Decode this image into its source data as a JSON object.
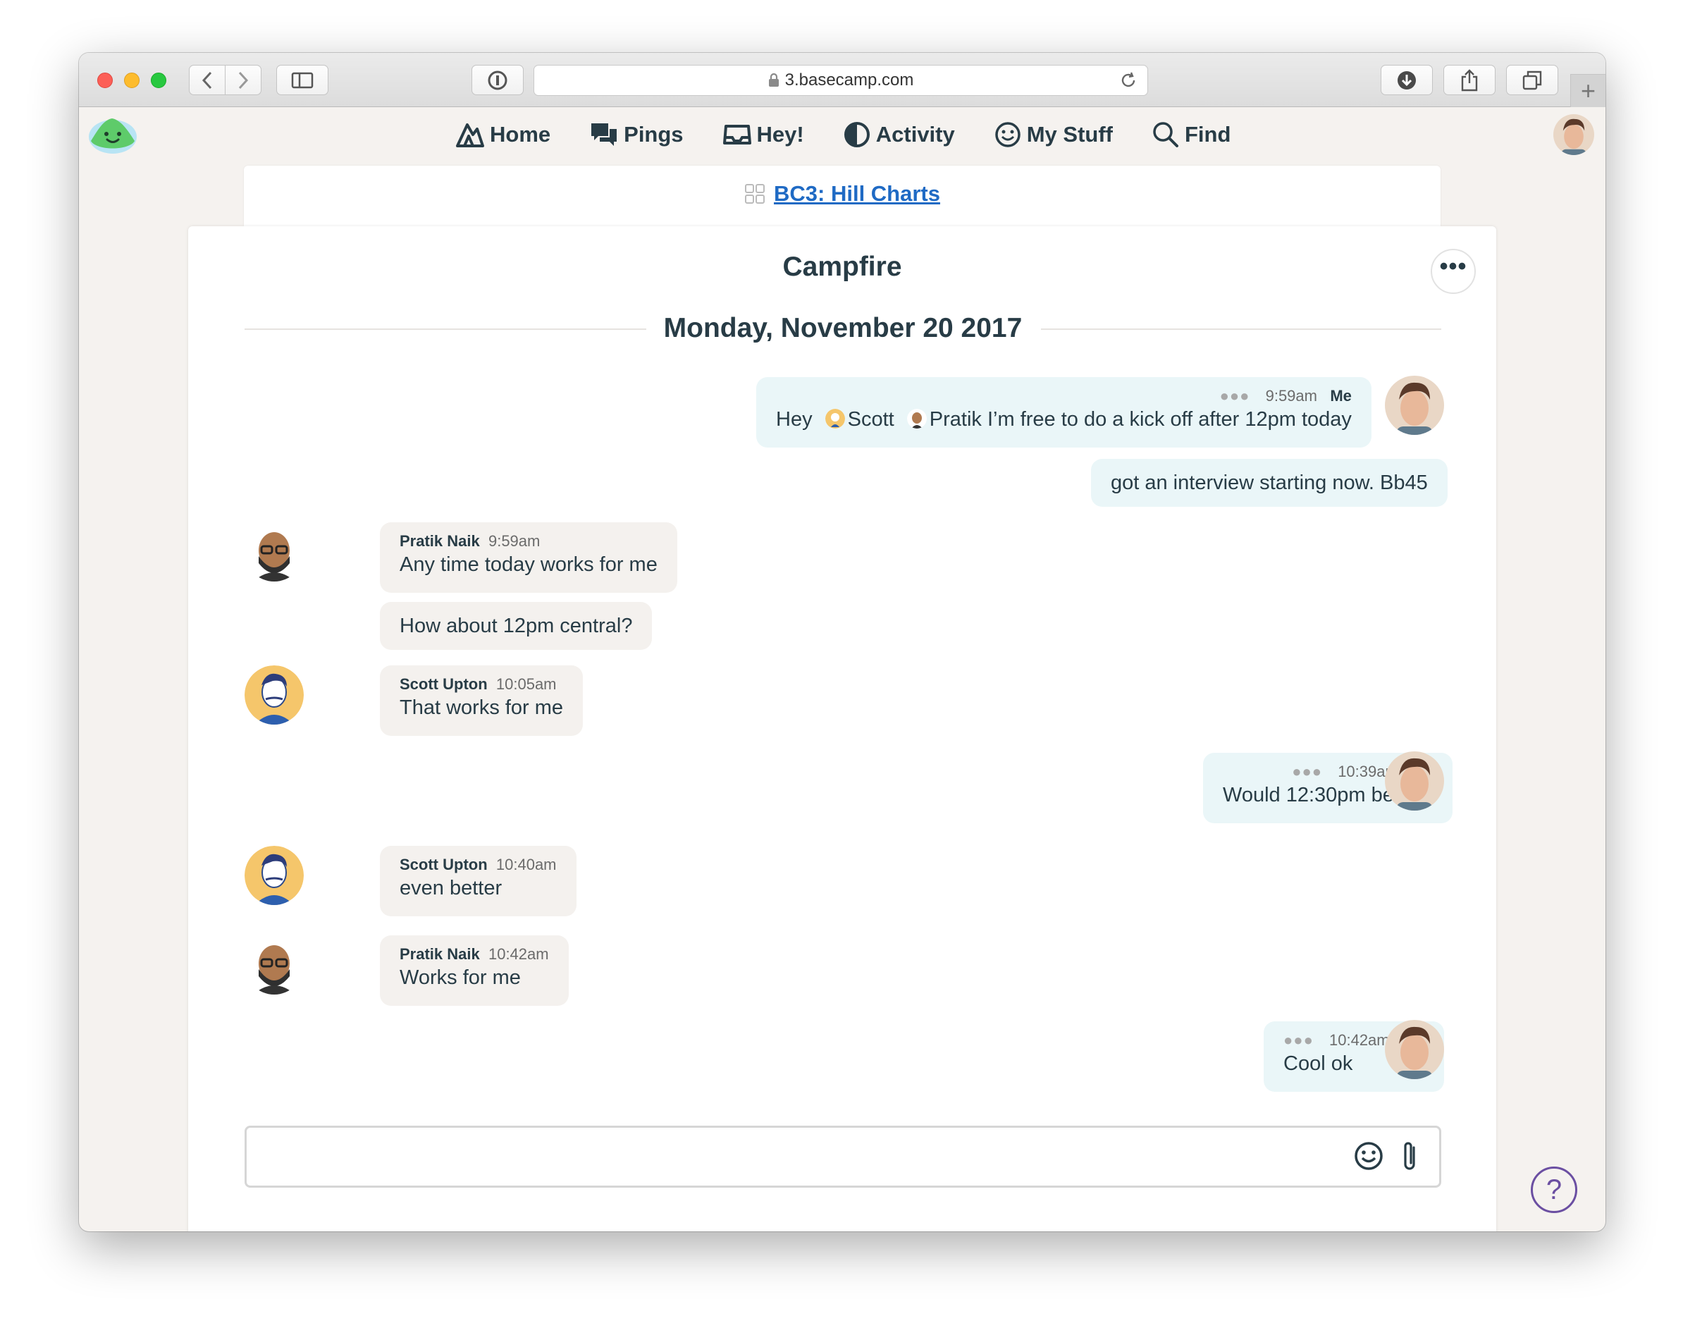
{
  "browser": {
    "url": "3.basecamp.com",
    "buttons": [
      "back",
      "forward",
      "sidebar",
      "password",
      "download",
      "share",
      "tabs",
      "new-tab"
    ]
  },
  "nav": {
    "items": [
      {
        "label": "Home",
        "icon": "mountain-icon"
      },
      {
        "label": "Pings",
        "icon": "chat-bubbles-icon"
      },
      {
        "label": "Hey!",
        "icon": "inbox-icon"
      },
      {
        "label": "Activity",
        "icon": "activity-icon"
      },
      {
        "label": "My Stuff",
        "icon": "smiley-icon"
      },
      {
        "label": "Find",
        "icon": "search-icon"
      }
    ]
  },
  "project": {
    "name": "BC3: Hill Charts"
  },
  "page": {
    "title": "Campfire",
    "more_label": "•••"
  },
  "day": {
    "date": "Monday, November 20 2017"
  },
  "messages": {
    "m1": {
      "time": "9:59am",
      "author": "Me",
      "text_a": "Hey",
      "mention_1": "Scott",
      "mention_2": "Pratik",
      "text_b": "I’m free to do a kick off after 12pm today",
      "text2": "got an interview starting now. Bb45"
    },
    "m2": {
      "author": "Pratik Naik",
      "time": "9:59am",
      "text": "Any time today works for me",
      "text2": "How about 12pm central?"
    },
    "m3": {
      "author": "Scott Upton",
      "time": "10:05am",
      "text": "That works for me"
    },
    "m4": {
      "time": "10:39am",
      "author": "Me",
      "text": "Would 12:30pm be ok?"
    },
    "m5": {
      "author": "Scott Upton",
      "time": "10:40am",
      "text": "even better"
    },
    "m6": {
      "author": "Pratik Naik",
      "time": "10:42am",
      "text": "Works for me"
    },
    "m7": {
      "time": "10:42am",
      "author": "Me",
      "text": "Cool ok"
    }
  },
  "composer": {
    "value": "",
    "emoji_icon": "smiley-icon",
    "attach_icon": "paperclip-icon"
  },
  "help": {
    "label": "?"
  },
  "colors": {
    "link": "#1f6ac4",
    "mine_bubble": "#eaf6f8",
    "theirs_bubble": "#f4f1ee",
    "help": "#6b4fa2"
  }
}
